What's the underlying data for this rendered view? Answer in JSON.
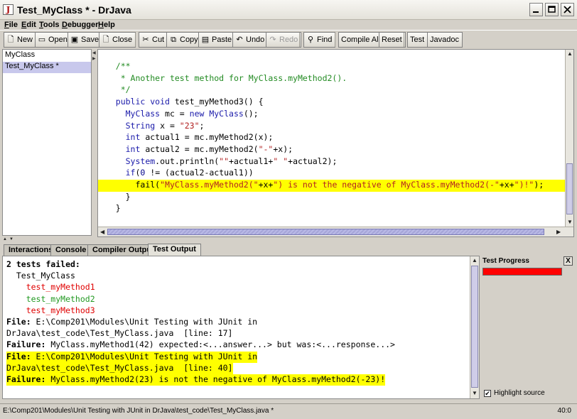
{
  "window": {
    "title": "Test_MyClass * - DrJava",
    "icon": "J"
  },
  "menu": [
    "File",
    "Edit",
    "Tools",
    "Debugger",
    "Help"
  ],
  "toolbar": {
    "new": "New",
    "open": "Open",
    "save": "Save",
    "close": "Close",
    "cut": "Cut",
    "copy": "Copy",
    "paste": "Paste",
    "undo": "Undo",
    "redo": "Redo",
    "find": "Find",
    "compile_all": "Compile All",
    "reset": "Reset",
    "test": "Test",
    "javadoc": "Javadoc"
  },
  "documents": [
    {
      "name": "MyClass",
      "selected": false
    },
    {
      "name": "Test_MyClass *",
      "selected": true
    }
  ],
  "editor": {
    "lines": [
      {
        "indent": "  ",
        "tokens": [
          [
            "c-comment",
            "/**"
          ]
        ]
      },
      {
        "indent": "   ",
        "tokens": [
          [
            "c-comment",
            "* Another test method for MyClass.myMethod2()."
          ]
        ]
      },
      {
        "indent": "   ",
        "tokens": [
          [
            "c-comment",
            "*/"
          ]
        ]
      },
      {
        "indent": "  ",
        "tokens": [
          [
            "c-kw",
            "public void"
          ],
          [
            "",
            " test_myMethod3() {"
          ]
        ]
      },
      {
        "indent": "    ",
        "tokens": [
          [
            "c-kw",
            "MyClass"
          ],
          [
            "",
            " mc = "
          ],
          [
            "c-kw",
            "new MyClass"
          ],
          [
            "",
            "();"
          ]
        ]
      },
      {
        "indent": "    ",
        "tokens": [
          [
            "c-kw",
            "String"
          ],
          [
            "",
            " x = "
          ],
          [
            "c-str",
            "\"23\""
          ],
          [
            "",
            ";"
          ]
        ]
      },
      {
        "indent": "    ",
        "tokens": [
          [
            "c-kw",
            "int"
          ],
          [
            "",
            " actual1 = mc.myMethod2(x);"
          ]
        ]
      },
      {
        "indent": "    ",
        "tokens": [
          [
            "c-kw",
            "int"
          ],
          [
            "",
            " actual2 = mc.myMethod2("
          ],
          [
            "c-str",
            "\"-\""
          ],
          [
            "",
            "+x);"
          ]
        ]
      },
      {
        "indent": "    ",
        "tokens": [
          [
            "c-kw",
            "System"
          ],
          [
            "",
            ".out.println("
          ],
          [
            "c-str",
            "\"\""
          ],
          [
            "",
            "+actual1+"
          ],
          [
            "c-str",
            "\" \""
          ],
          [
            "",
            "+actual2);"
          ]
        ]
      },
      {
        "indent": "    ",
        "tokens": [
          [
            "c-kw",
            "if"
          ],
          [
            "",
            "("
          ],
          [
            "c-num",
            "0"
          ],
          [
            "",
            " != (actual2-actual1))"
          ]
        ]
      },
      {
        "indent": "      ",
        "hl": true,
        "tokens": [
          [
            "",
            "fail("
          ],
          [
            "c-str",
            "\"MyClass.myMethod2(\""
          ],
          [
            "",
            "+x+"
          ],
          [
            "c-str",
            "\") is not the negative of MyClass.myMethod2(-\""
          ],
          [
            "",
            "+x+"
          ],
          [
            "c-str",
            "\")!\""
          ],
          [
            "",
            ");"
          ]
        ]
      },
      {
        "indent": "    ",
        "tokens": [
          [
            "",
            "}"
          ]
        ]
      },
      {
        "indent": "  ",
        "tokens": [
          [
            "",
            "}"
          ]
        ]
      }
    ]
  },
  "tabs": [
    {
      "label": "Interactions",
      "active": false
    },
    {
      "label": "Console",
      "active": false
    },
    {
      "label": "Compiler Output",
      "active": false
    },
    {
      "label": "Test Output",
      "active": true
    }
  ],
  "test_output": {
    "lines": [
      {
        "parts": [
          [
            "b",
            "2 tests failed:"
          ]
        ]
      },
      {
        "parts": [
          [
            "",
            "  Test_MyClass"
          ]
        ]
      },
      {
        "parts": [
          [
            "out-red",
            "    test_myMethod1"
          ]
        ]
      },
      {
        "parts": [
          [
            "out-green",
            "    test_myMethod2"
          ]
        ]
      },
      {
        "parts": [
          [
            "out-red",
            "    test_myMethod3"
          ]
        ]
      },
      {
        "parts": [
          [
            "b",
            "File:"
          ],
          [
            "",
            " E:\\Comp201\\Modules\\Unit Testing with JUnit in"
          ]
        ]
      },
      {
        "parts": [
          [
            "",
            "DrJava\\test_code\\Test_MyClass.java  [line: 17]"
          ]
        ]
      },
      {
        "parts": [
          [
            "b",
            "Failure:"
          ],
          [
            "",
            " MyClass.myMethod1(42) expected:<...answer...> but was:<...response...>"
          ]
        ]
      },
      {
        "hl": true,
        "parts": [
          [
            "b",
            "File:"
          ],
          [
            "",
            " E:\\Comp201\\Modules\\Unit Testing with JUnit in"
          ]
        ]
      },
      {
        "hl": true,
        "parts": [
          [
            "",
            "DrJava\\test_code\\Test_MyClass.java  [line: 40]"
          ]
        ]
      },
      {
        "hl": true,
        "parts": [
          [
            "b",
            "Failure:"
          ],
          [
            "",
            " MyClass.myMethod2(23) is not the negative of MyClass.myMethod2(-23)!"
          ]
        ]
      }
    ]
  },
  "test_progress": {
    "title": "Test Progress",
    "close": "X",
    "fraction": 1.0,
    "color": "#ff0000"
  },
  "highlight_source": {
    "label": "Highlight source",
    "checked": true
  },
  "status": {
    "path": "E:\\Comp201\\Modules\\Unit Testing with JUnit in DrJava\\test_code\\Test_MyClass.java *",
    "position": "40:0"
  }
}
